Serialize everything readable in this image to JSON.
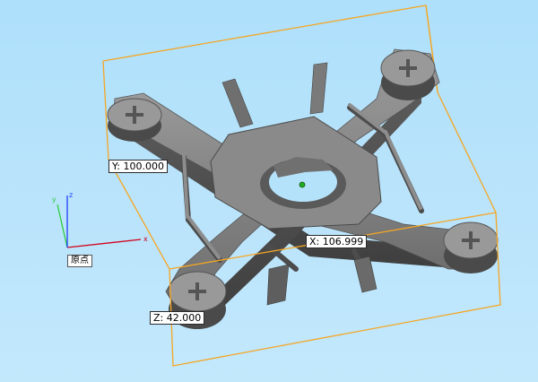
{
  "dimensions": {
    "y_label": "Y: 100.000",
    "x_label": "X: 106.999",
    "z_label": "Z: 42.000"
  },
  "axes": {
    "x": "x",
    "y": "y",
    "z": "z",
    "origin_label": "原点"
  },
  "colors": {
    "background": "#b5e2fb",
    "bounding_box": "#f5a623",
    "model_gray": "#808080",
    "axis_x": "#d0021b",
    "axis_y": "#2ecc40",
    "axis_z": "#1f3fff",
    "center_marker": "#22aa22"
  }
}
